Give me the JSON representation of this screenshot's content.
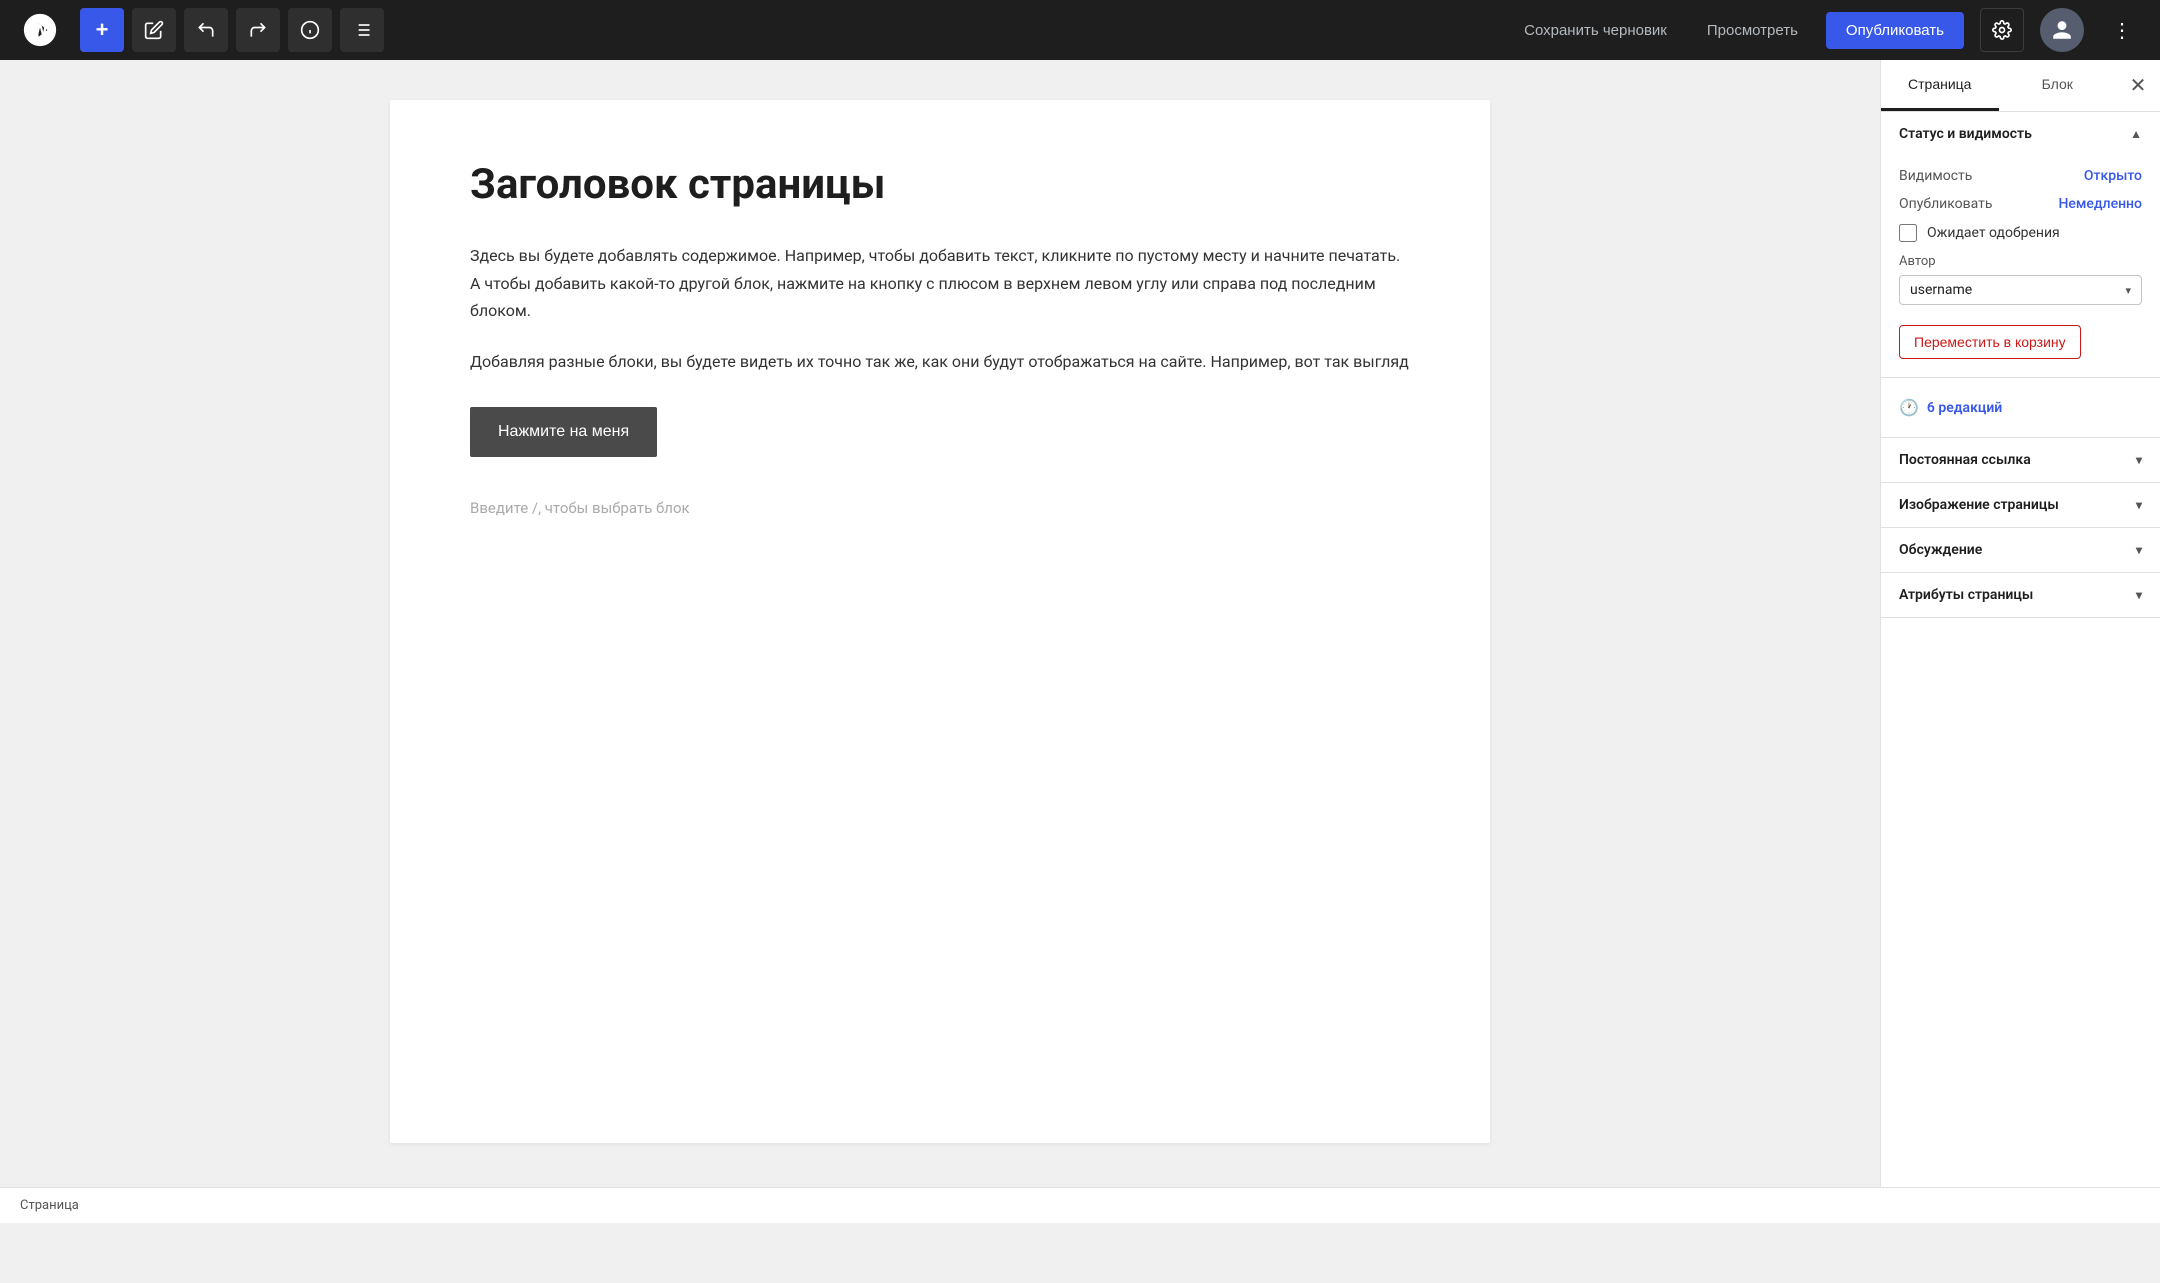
{
  "toolbar": {
    "add_label": "+",
    "save_draft_label": "Сохранить черновик",
    "preview_label": "Просмотреть",
    "publish_label": "Опубликовать"
  },
  "editor": {
    "page_title": "Заголовок страницы",
    "paragraph1": "Здесь вы будете добавлять содержимое. Например, чтобы добавить текст, кликните по пустому месту и начните печатать. А чтобы добавить какой-то другой блок, нажмите на кнопку с плюсом в верхнем левом углу или справа под последним блоком.",
    "paragraph2": "Добавляя разные блоки, вы будете видеть их точно так же, как они будут отображаться на сайте. Например, вот так выгляд",
    "cta_button_label": "Нажмите на меня",
    "placeholder": "Введите /, чтобы выбрать блок"
  },
  "sidebar": {
    "tab_page_label": "Страница",
    "tab_block_label": "Блок",
    "sections": {
      "status_visibility": {
        "header": "Статус и видимость",
        "visibility_label": "Видимость",
        "visibility_value": "Открыто",
        "publish_label": "Опубликовать",
        "publish_value": "Немедленно",
        "awaiting_label": "Ожидает одобрения",
        "author_label": "Автор",
        "author_value": "username",
        "trash_label": "Переместить в корзину"
      },
      "revisions": {
        "count_label": "6 редакций"
      },
      "permalink": {
        "header": "Постоянная ссылка"
      },
      "featured_image": {
        "header": "Изображение страницы"
      },
      "discussion": {
        "header": "Обсуждение"
      },
      "page_attributes": {
        "header": "Атрибуты страницы"
      }
    }
  },
  "status_bar": {
    "label": "Страница"
  }
}
